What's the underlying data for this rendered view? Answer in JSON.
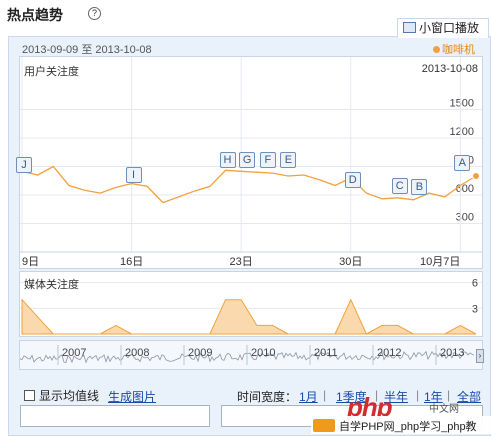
{
  "page": {
    "title": "热点趋势",
    "help_icon": "?"
  },
  "tab": {
    "label": "小窗口播放",
    "icon": "tv-icon"
  },
  "range": {
    "text": "2013-09-09 至 2013-10-08"
  },
  "legend": {
    "label": "咖啡机",
    "color": "#f3a03c"
  },
  "chart_data": [
    {
      "type": "line",
      "title": "用户关注度",
      "corner_date": "2013-10-08",
      "yticks": [
        "1500",
        "1200",
        "900",
        "600",
        "300"
      ],
      "ylim": [
        0,
        1800
      ],
      "xticks": [
        "9日",
        "16日",
        "23日",
        "30日",
        "10月7日"
      ],
      "x": [
        "09-09",
        "09-10",
        "09-11",
        "09-12",
        "09-13",
        "09-14",
        "09-15",
        "09-16",
        "09-17",
        "09-18",
        "09-19",
        "09-20",
        "09-21",
        "09-22",
        "09-23",
        "09-24",
        "09-25",
        "09-26",
        "09-27",
        "09-28",
        "09-29",
        "09-30",
        "10-01",
        "10-02",
        "10-03",
        "10-04",
        "10-05",
        "10-06",
        "10-07",
        "10-08"
      ],
      "series": [
        {
          "name": "咖啡机",
          "values": [
            850,
            810,
            900,
            700,
            650,
            620,
            680,
            720,
            690,
            520,
            580,
            640,
            690,
            860,
            850,
            840,
            830,
            800,
            810,
            760,
            700,
            780,
            620,
            560,
            570,
            550,
            620,
            580,
            700,
            800
          ]
        }
      ],
      "markers": [
        {
          "label": "J",
          "date": "09-09"
        },
        {
          "label": "I",
          "date": "09-16"
        },
        {
          "label": "H",
          "date": "09-22"
        },
        {
          "label": "G",
          "date": "09-23"
        },
        {
          "label": "F",
          "date": "09-24"
        },
        {
          "label": "E",
          "date": "09-25"
        },
        {
          "label": "D",
          "date": "09-30"
        },
        {
          "label": "C",
          "date": "10-03"
        },
        {
          "label": "B",
          "date": "10-04"
        },
        {
          "label": "A",
          "date": "10-07"
        }
      ],
      "color": "#f3a03c",
      "grid": true
    },
    {
      "type": "area",
      "title": "媒体关注度",
      "yticks": [
        "6",
        "3"
      ],
      "ylim": [
        0,
        7
      ],
      "series": [
        {
          "name": "咖啡机",
          "values": [
            4,
            2,
            0,
            0,
            0,
            0,
            1,
            0,
            0,
            0,
            0,
            0,
            0,
            4,
            4,
            1,
            1,
            0,
            0,
            0,
            0,
            4,
            0,
            1,
            1,
            0,
            0,
            0,
            1,
            0
          ]
        }
      ],
      "color": "#f3a03c"
    }
  ],
  "overview": {
    "years": [
      "2007",
      "2008",
      "2009",
      "2010",
      "2011",
      "2012",
      "2013"
    ]
  },
  "controls": {
    "checkbox_label": "显示均值线",
    "generate_image": "生成图片",
    "span_label": "时间宽度：",
    "spans": [
      "1月",
      "1季度",
      "半年",
      "1年",
      "全部"
    ]
  },
  "watermark": {
    "logo": "php",
    "site": "中文网",
    "text": "自学PHP网_php学习_php教"
  }
}
